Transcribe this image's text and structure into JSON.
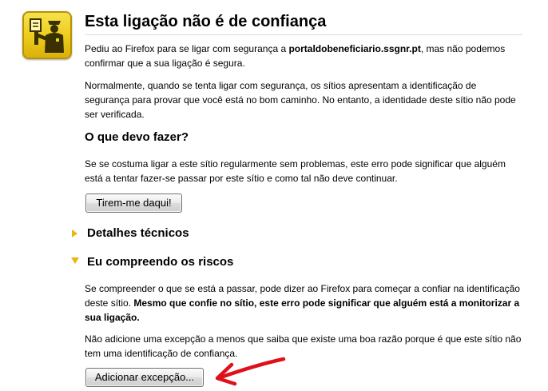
{
  "header": {
    "title": "Esta ligação não é de confiança",
    "icon": "security-officer-icon"
  },
  "intro": {
    "text_before": "Pediu ao Firefox para se ligar com segurança a ",
    "host": "portaldobeneficiario.ssgnr.pt",
    "text_after": ", mas não podemos confirmar que a sua ligação é segura."
  },
  "normally": {
    "text": "Normalmente, quando se tenta ligar com segurança, os sítios apresentam a identificação de segurança para provar que você está no bom caminho. No entanto, a identidade deste sítio não pode ser verificada."
  },
  "what_to_do": {
    "heading": "O que devo fazer?",
    "text": "Se se costuma ligar a este sítio regularmente sem problemas, este erro pode significar que alguém está a tentar fazer-se passar por este sítio e como tal não deve continuar.",
    "button_label": "Tirem-me daqui!"
  },
  "technical_details": {
    "heading": "Detalhes técnicos",
    "expanded": false
  },
  "risks": {
    "heading": "Eu compreendo os riscos",
    "expanded": true,
    "text_before": "Se compreender o que se está a passar, pode dizer ao Firefox para começar a confiar na identificação deste sítio. ",
    "text_bold": "Mesmo que confie no sítio, este erro pode significar que alguém está a monitorizar a sua ligação.",
    "text2": "Não adicione uma excepção a menos que saiba que existe uma boa razão porque é que este sítio não tem uma identificação de confiança.",
    "button_label": "Adicionar excepção..."
  },
  "annotation": {
    "arrow_color": "#e0101a"
  },
  "colors": {
    "badge_yellow": "#f0cf22",
    "twisty_yellow": "#e8b615"
  }
}
